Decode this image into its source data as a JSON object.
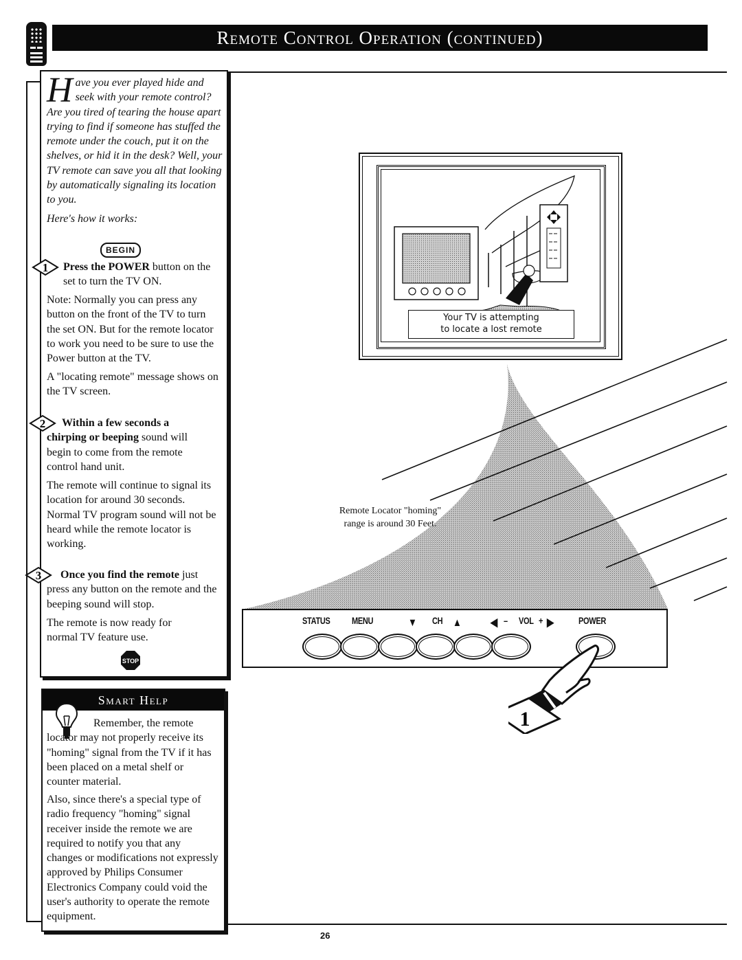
{
  "header": {
    "title": "Remote Control Operation (continued)",
    "icon": "remote-control-icon"
  },
  "intro": {
    "dropcap": "H",
    "text": "ave you ever played hide and seek with your remote control? Are you tired of tearing the house apart trying to find if someone has stuffed the remote under the couch, put it on the shelves, or hid it in the desk? Well, your TV remote can save you all that looking by automatically signaling its location to you.",
    "how_it_works": "Here's how it works:",
    "begin_label": "BEGIN"
  },
  "steps": [
    {
      "number": "1",
      "bold": "Press the POWER",
      "text": " button on the set to turn the TV ON.",
      "notes": [
        "Note: Normally you can press any button on the front of the TV to turn the set ON. But for the remote locator to work you need to be sure to use the Power button at the TV.",
        "A \"locating remote\" message shows on the TV screen."
      ]
    },
    {
      "number": "2",
      "bold": "Within a few seconds a chirping or beeping",
      "text": " sound will begin to come from the remote control hand unit.",
      "notes": [
        "The remote will continue to signal its location for around 30 seconds. Normal TV program sound will not be heard while the remote locator is working."
      ]
    },
    {
      "number": "3",
      "bold": "Once you find the remote",
      "text": " just press any button on the remote and the beeping sound will stop.",
      "notes": [
        "The remote is now ready for normal TV feature use."
      ]
    }
  ],
  "stop_label": "STOP",
  "smart_help": {
    "title": "Smart Help",
    "paragraphs": [
      "Remember, the remote locator may not properly receive its \"homing\" signal from the TV if it has been placed on a metal shelf or counter material.",
      "Also, since there's a special type of radio frequency \"homing\" signal receiver inside the remote we are required to notify you that any changes or modifications not expressly approved by Philips Consumer Electronics Company could void the user's authority to operate the remote equipment."
    ]
  },
  "tv_screen": {
    "osd_line1": "Your TV is attempting",
    "osd_line2": "to locate a lost remote"
  },
  "caption": {
    "line1": "Remote Locator \"homing\"",
    "line2": "range is around 30 Feet."
  },
  "control_panel": {
    "labels": [
      "STATUS",
      "MENU",
      "▼",
      "CH",
      "▲",
      "◀",
      "–",
      "VOL",
      "+",
      "▶",
      "POWER"
    ],
    "buttons": [
      "status",
      "menu",
      "channel-down",
      "channel-up",
      "volume-down",
      "volume-up",
      "power"
    ],
    "callout_number": "1"
  },
  "page_number": "26"
}
